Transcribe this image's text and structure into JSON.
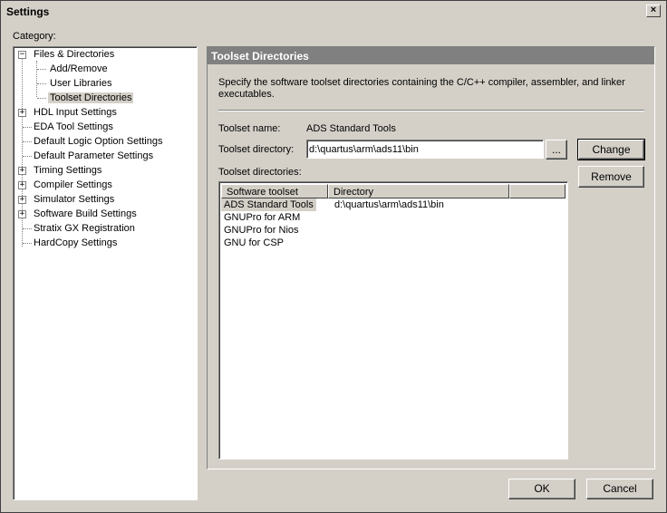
{
  "window": {
    "title": "Settings",
    "close_glyph": "×"
  },
  "category_label": "Category:",
  "tree": [
    {
      "label": "Files & Directories",
      "expander": "−"
    },
    {
      "label": "Add/Remove"
    },
    {
      "label": "User Libraries"
    },
    {
      "label": "Toolset Directories",
      "selected": true
    },
    {
      "label": "HDL Input Settings",
      "expander": "+"
    },
    {
      "label": "EDA Tool Settings"
    },
    {
      "label": "Default Logic Option Settings"
    },
    {
      "label": "Default Parameter Settings"
    },
    {
      "label": "Timing Settings",
      "expander": "+"
    },
    {
      "label": "Compiler Settings",
      "expander": "+"
    },
    {
      "label": "Simulator Settings",
      "expander": "+"
    },
    {
      "label": "Software Build Settings",
      "expander": "+"
    },
    {
      "label": "Stratix GX Registration"
    },
    {
      "label": "HardCopy Settings"
    }
  ],
  "panel": {
    "title": "Toolset Directories",
    "description_line1": "Specify the software toolset directories containing the C/C++ compiler, assembler, and linker",
    "description_line2": "executables.",
    "toolset_name_label": "Toolset name:",
    "toolset_name_value": "ADS Standard Tools",
    "toolset_directory_label": "Toolset directory:",
    "toolset_directory_value": "d:\\quartus\\arm\\ads11\\bin",
    "browse_label": "...",
    "change_label": "Change",
    "remove_label": "Remove",
    "toolset_directories_label": "Toolset directories:",
    "columns": [
      "Software toolset",
      "Directory"
    ],
    "rows": [
      {
        "toolset": "ADS Standard Tools",
        "directory": "d:\\quartus\\arm\\ads11\\bin",
        "selected": true
      },
      {
        "toolset": "GNUPro for ARM",
        "directory": ""
      },
      {
        "toolset": "GNUPro for Nios",
        "directory": ""
      },
      {
        "toolset": "GNU for CSP",
        "directory": ""
      }
    ]
  },
  "footer": {
    "ok_label": "OK",
    "cancel_label": "Cancel"
  }
}
